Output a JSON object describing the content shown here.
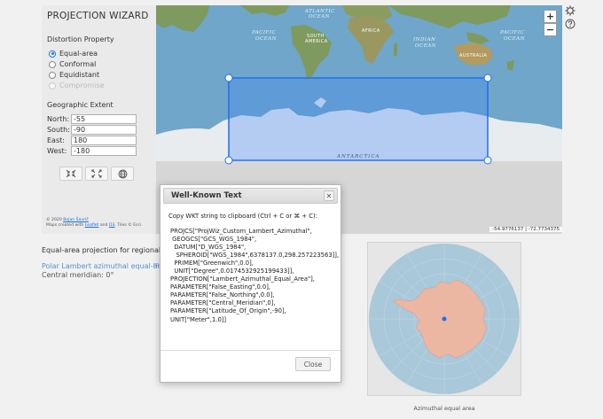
{
  "app": {
    "title": "PROJECTION WIZARD"
  },
  "distortion": {
    "heading": "Distortion Property",
    "options": [
      {
        "label": "Equal-area",
        "checked": true,
        "enabled": true
      },
      {
        "label": "Conformal",
        "checked": false,
        "enabled": true
      },
      {
        "label": "Equidistant",
        "checked": false,
        "enabled": true
      },
      {
        "label": "Compromise",
        "checked": false,
        "enabled": false
      }
    ]
  },
  "extent": {
    "heading": "Geographic Extent",
    "north": {
      "label": "North:",
      "value": "-55"
    },
    "south": {
      "label": "South:",
      "value": "-90"
    },
    "east": {
      "label": "East:",
      "value": "180"
    },
    "west": {
      "label": "West:",
      "value": "-180"
    }
  },
  "credits": {
    "prefix": "© 2020 ",
    "author": "Bojan Šavrič",
    "line2_a": "Maps created with ",
    "leaflet": "Leaflet",
    "line2_b": " and ",
    "d3": "D3",
    "line2_c": ". Tiles © Esri."
  },
  "map": {
    "zoom_in": "+",
    "zoom_out": "−",
    "coordinates": "-54.9776137 | -72.7734375",
    "labels": {
      "atlantic_1": "ATLANTIC",
      "atlantic_2": "OCEAN",
      "pacific_1": "PACIFIC",
      "pacific_2": "OCEAN",
      "pacific_3": "PACIFIC",
      "pacific_4": "OCEAN",
      "south_america_1": "SOUTH",
      "south_america_2": "AMERICA",
      "africa": "AFRICA",
      "indian_1": "INDIAN",
      "indian_2": "OCEAN",
      "australia": "AUSTRALIA",
      "antarctica": "ANTARCTICA"
    }
  },
  "result": {
    "heading": "Equal-area projection for regional maps",
    "link": "Polar Lambert azimuthal equal-area",
    "link_suffix": "PRJ",
    "meridian": "Central meridian: 0°"
  },
  "preview": {
    "caption": "Azimuthal equal area"
  },
  "dialog": {
    "title": "Well-Known Text",
    "close_x": "✕",
    "instructions": "Copy WKT string to clipboard (Ctrl + C or ⌘ + C):",
    "wkt": "PROJCS[\"ProjWiz_Custom_Lambert_Azimuthal\",\n GEOGCS[\"GCS_WGS_1984\",\n  DATUM[\"D_WGS_1984\",\n   SPHEROID[\"WGS_1984\",6378137.0,298.257223563]],\n  PRIMEM[\"Greenwich\",0.0],\n  UNIT[\"Degree\",0.0174532925199433]],\nPROJECTION[\"Lambert_Azimuthal_Equal_Area\"],\nPARAMETER[\"False_Easting\",0.0],\nPARAMETER[\"False_Northing\",0.0],\nPARAMETER[\"Central_Meridian\",0],\nPARAMETER[\"Latitude_Of_Origin\",-90],\nUNIT[\"Meter\",1.0]]",
    "close_button": "Close"
  },
  "colors": {
    "ocean": "#6fa6c9",
    "land": "#7e9a5e",
    "antarctica": "#e8ecef",
    "selection": "#1e6ff0",
    "preview_ocean": "#a9c8da",
    "preview_land": "#ebb6a2"
  }
}
